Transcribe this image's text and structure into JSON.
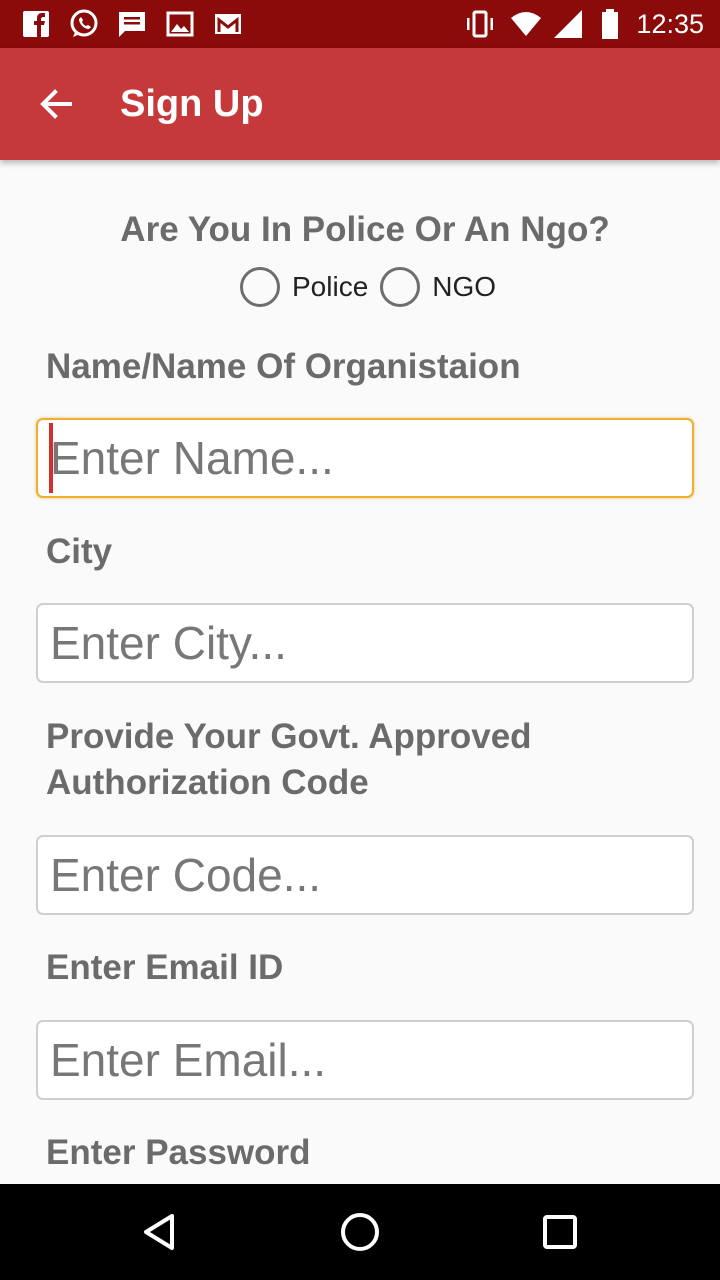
{
  "status_bar": {
    "time": "12:35",
    "left_icons": [
      "facebook-icon",
      "whatsapp-icon",
      "message-icon",
      "gallery-icon",
      "gmail-icon"
    ],
    "right_icons": [
      "vibrate-icon",
      "wifi-icon",
      "signal-icon",
      "battery-icon"
    ]
  },
  "app_bar": {
    "title": "Sign Up",
    "background": "#c5393a",
    "status_background": "#8b0b0b"
  },
  "form": {
    "question": "Are You In Police Or An Ngo?",
    "radio_options": [
      {
        "label": "Police",
        "selected": false
      },
      {
        "label": "NGO",
        "selected": false
      }
    ],
    "fields": [
      {
        "label": "Name/Name Of Organistaion",
        "placeholder": "Enter Name...",
        "value": "",
        "focused": true
      },
      {
        "label": "City",
        "placeholder": "Enter City...",
        "value": "",
        "focused": false
      },
      {
        "label": "Provide Your Govt. Approved Authorization Code",
        "placeholder": "Enter Code...",
        "value": "",
        "focused": false
      },
      {
        "label": "Enter Email ID",
        "placeholder": "Enter Email...",
        "value": "",
        "focused": false
      },
      {
        "label": "Enter Password"
      }
    ]
  },
  "nav_bar": {
    "buttons": [
      "back-triangle-icon",
      "home-circle-icon",
      "recents-square-icon"
    ]
  }
}
